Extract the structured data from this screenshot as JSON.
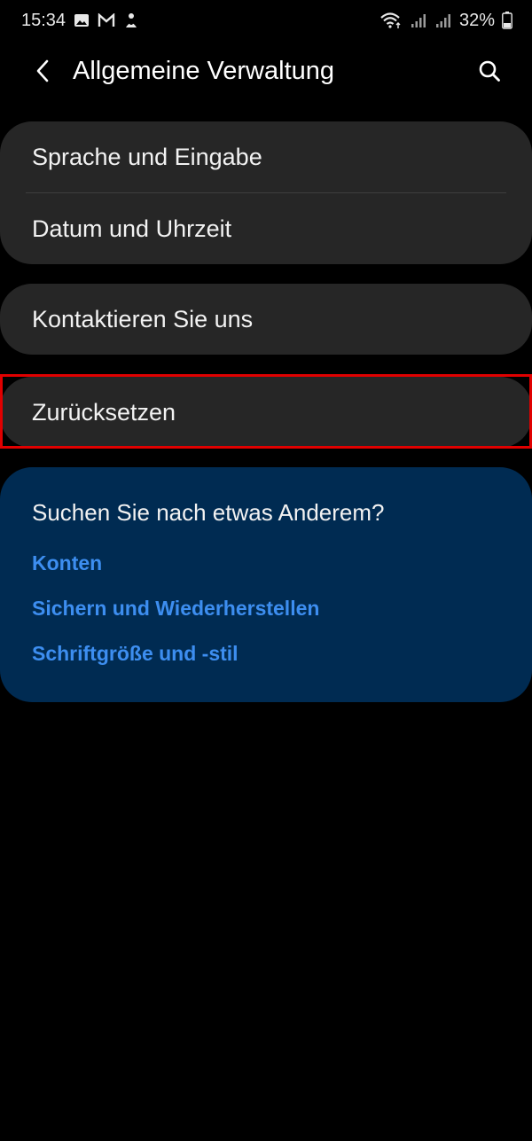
{
  "status_bar": {
    "time": "15:34",
    "battery": "32%",
    "icons_left": [
      "gallery-icon",
      "gmail-icon",
      "notification-icon"
    ],
    "icons_right": [
      "wifi-icon",
      "signal-icon",
      "signal-icon",
      "battery-icon"
    ]
  },
  "header": {
    "title": "Allgemeine Verwaltung"
  },
  "group1": {
    "items": [
      {
        "label": "Sprache und Eingabe"
      },
      {
        "label": "Datum und Uhrzeit"
      }
    ]
  },
  "group2": {
    "items": [
      {
        "label": "Kontaktieren Sie uns"
      }
    ]
  },
  "group3": {
    "items": [
      {
        "label": "Zurücksetzen"
      }
    ]
  },
  "suggestions": {
    "title": "Suchen Sie nach etwas Anderem?",
    "links": [
      {
        "label": "Konten"
      },
      {
        "label": "Sichern und Wiederherstellen"
      },
      {
        "label": "Schriftgröße und -stil"
      }
    ]
  },
  "colors": {
    "background": "#000000",
    "card": "#262626",
    "suggest_card": "#002b52",
    "link": "#3d8ef0",
    "highlight": "#e00000"
  }
}
